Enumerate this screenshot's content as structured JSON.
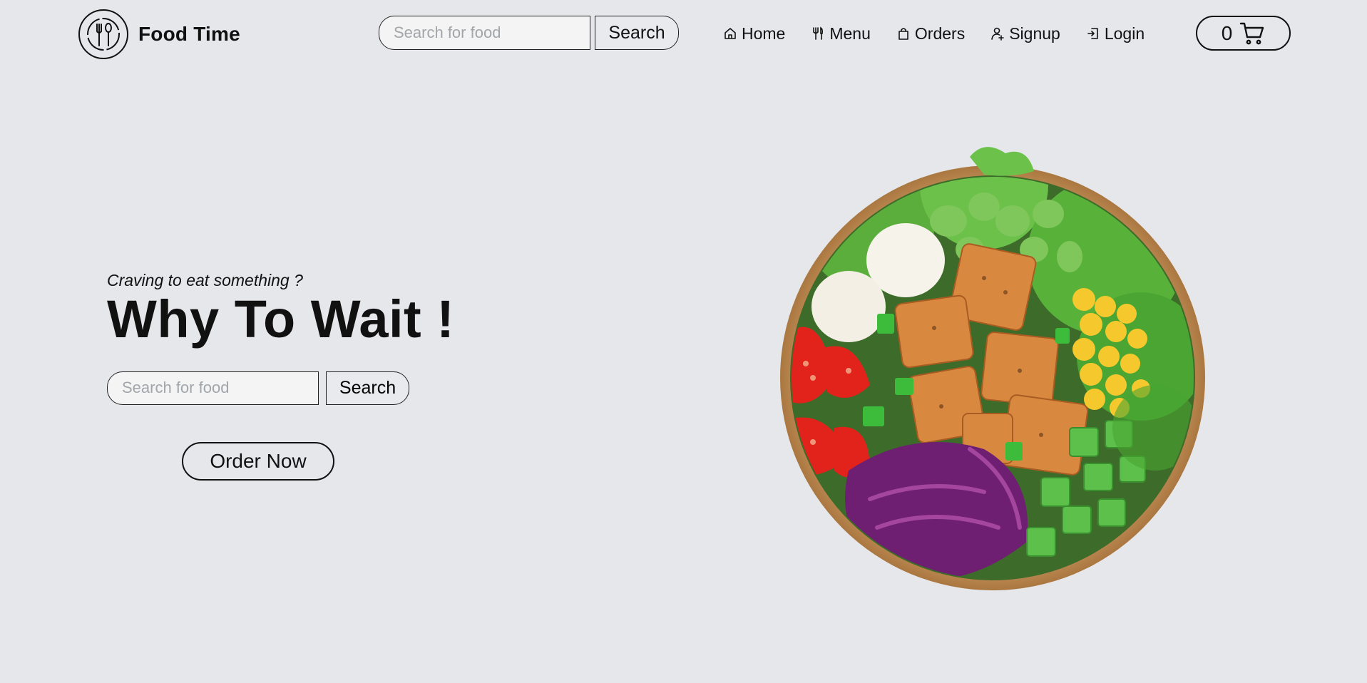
{
  "brand": {
    "name": "Food Time",
    "logo_icon": "fork-spoon-icon"
  },
  "header_search": {
    "placeholder": "Search for food",
    "value": "",
    "button_label": "Search"
  },
  "nav": [
    {
      "label": "Home",
      "icon": "home-icon"
    },
    {
      "label": "Menu",
      "icon": "utensils-icon"
    },
    {
      "label": "Orders",
      "icon": "bag-icon"
    },
    {
      "label": "Signup",
      "icon": "user-plus-icon"
    },
    {
      "label": "Login",
      "icon": "login-icon"
    }
  ],
  "cart": {
    "count": "0",
    "icon": "cart-icon"
  },
  "hero": {
    "tagline": "Craving to eat something ?",
    "headline": "Why To Wait !",
    "search": {
      "placeholder": "Search for food",
      "value": "",
      "button_label": "Search"
    },
    "cta_label": "Order Now",
    "image": "salad-bowl-image"
  },
  "colors": {
    "background": "#e6e7eb",
    "text": "#111111",
    "input_bg": "#f3f4f3",
    "placeholder": "#a2a6ab"
  }
}
